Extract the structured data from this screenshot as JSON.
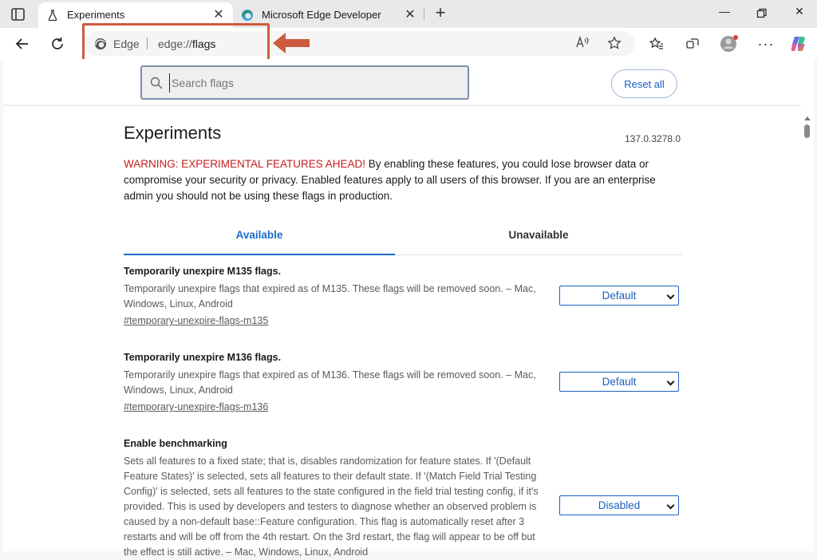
{
  "tabs": [
    {
      "title": "Experiments",
      "active": true,
      "icon": "flask-icon"
    },
    {
      "title": "Microsoft Edge Developer",
      "active": false,
      "icon": "edge-logo-icon"
    }
  ],
  "address_bar": {
    "site_label": "Edge",
    "url_prefix": "edge://",
    "url_host": "flags"
  },
  "search": {
    "placeholder": "Search flags",
    "reset_label": "Reset all"
  },
  "page": {
    "title": "Experiments",
    "version": "137.0.3278.0",
    "warning_red": "WARNING: EXPERIMENTAL FEATURES AHEAD!",
    "warning_text": " By enabling these features, you could lose browser data or compromise your security or privacy. Enabled features apply to all users of this browser. If you are an enterprise admin you should not be using these flags in production.",
    "tabs": [
      "Available",
      "Unavailable"
    ]
  },
  "flags": [
    {
      "title": "Temporarily unexpire M135 flags.",
      "description": "Temporarily unexpire flags that expired as of M135. These flags will be removed soon. – Mac, Windows, Linux, Android",
      "link": "#temporary-unexpire-flags-m135",
      "value": "Default"
    },
    {
      "title": "Temporarily unexpire M136 flags.",
      "description": "Temporarily unexpire flags that expired as of M136. These flags will be removed soon. – Mac, Windows, Linux, Android",
      "link": "#temporary-unexpire-flags-m136",
      "value": "Default"
    },
    {
      "title": "Enable benchmarking",
      "description": "Sets all features to a fixed state; that is, disables randomization for feature states. If '(Default Feature States)' is selected, sets all features to their default state. If '(Match Field Trial Testing Config)' is selected, sets all features to the state configured in the field trial testing config, if it's provided. This is used by developers and testers to diagnose whether an observed problem is caused by a non-default base::Feature configuration. This flag is automatically reset after 3 restarts and will be off from the 4th restart. On the 3rd restart, the flag will appear to be off but the effect is still active. – Mac, Windows, Linux, Android",
      "value": "Disabled"
    }
  ],
  "colors": {
    "accent": "#1b6ac9",
    "warning": "#c41d1d",
    "highlight": "#cf5b3e"
  }
}
